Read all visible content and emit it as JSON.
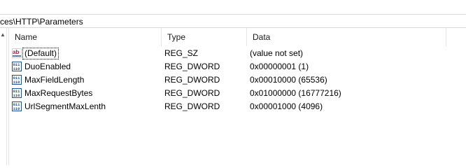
{
  "address_bar": {
    "path": "ces\\HTTP\\Parameters"
  },
  "list": {
    "columns": {
      "name": "Name",
      "type": "Type",
      "data": "Data"
    },
    "rows": [
      {
        "name": "(Default)",
        "type": "REG_SZ",
        "data": "(value not set)",
        "icon": "string-value-icon"
      },
      {
        "name": "DuoEnabled",
        "type": "REG_DWORD",
        "data": "0x00000001 (1)",
        "icon": "binary-value-icon"
      },
      {
        "name": "MaxFieldLength",
        "type": "REG_DWORD",
        "data": "0x00010000 (65536)",
        "icon": "binary-value-icon"
      },
      {
        "name": "MaxRequestBytes",
        "type": "REG_DWORD",
        "data": "0x01000000 (16777216)",
        "icon": "binary-value-icon"
      },
      {
        "name": "UrlSegmentMaxLenth",
        "type": "REG_DWORD",
        "data": "0x00001000 (4096)",
        "icon": "binary-value-icon"
      }
    ]
  },
  "colors": {
    "string_icon_red": "#c8102e",
    "binary_icon_blue": "#1f4e9c"
  }
}
